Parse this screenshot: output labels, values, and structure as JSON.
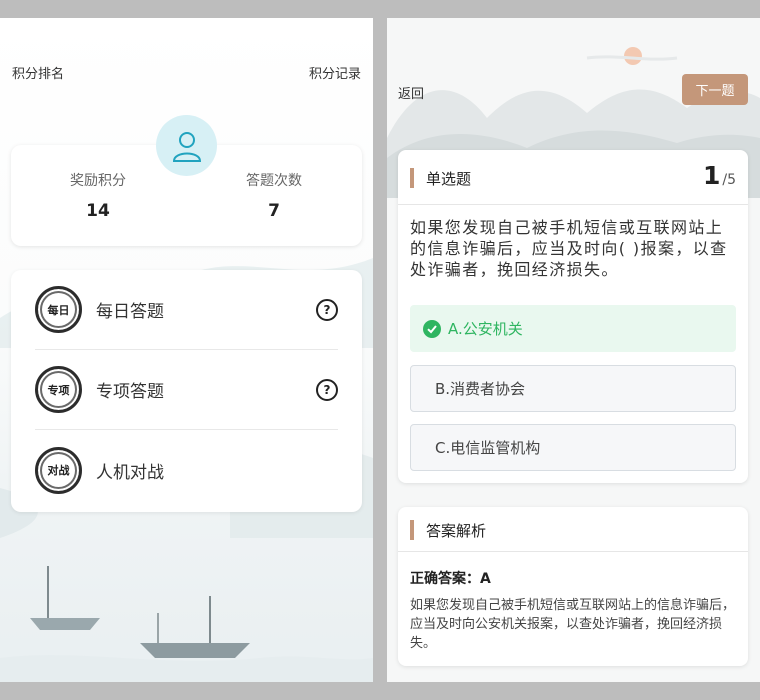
{
  "left": {
    "rank_link": "积分排名",
    "record_link": "积分记录",
    "stats": {
      "points_label": "奖励积分",
      "points_value": "14",
      "count_label": "答题次数",
      "count_value": "7"
    },
    "menu": [
      {
        "seal": "每日",
        "label": "每日答题",
        "has_help": true
      },
      {
        "seal": "专项",
        "label": "专项答题",
        "has_help": true
      },
      {
        "seal": "对战",
        "label": "人机对战",
        "has_help": false
      }
    ],
    "help_symbol": "?"
  },
  "right": {
    "back_link": "返回",
    "next_button": "下一题",
    "question": {
      "type_label": "单选题",
      "current": "1",
      "total": "/5",
      "text": "如果您发现自己被手机短信或互联网站上的信息诈骗后，应当及时向(  )报案，以查处诈骗者，挽回经济损失。",
      "options": [
        {
          "label": "A.公安机关",
          "state": "correct"
        },
        {
          "label": "B.消费者协会",
          "state": "normal"
        },
        {
          "label": "C.电信监管机构",
          "state": "normal"
        }
      ]
    },
    "analysis": {
      "title": "答案解析",
      "correct_answer": "正确答案：A",
      "explanation": "如果您发现自己被手机短信或互联网站上的信息诈骗后，应当及时向公安机关报案，以查处诈骗者，挽回经济损失。"
    }
  },
  "colors": {
    "accent": "#c4977a",
    "correct": "#2fb561",
    "avatar_bg": "#d7f0f5",
    "avatar_icon": "#21a3bf"
  },
  "icons": {
    "avatar": "user-icon",
    "help": "help-circle-icon",
    "check": "check-circle-icon"
  }
}
